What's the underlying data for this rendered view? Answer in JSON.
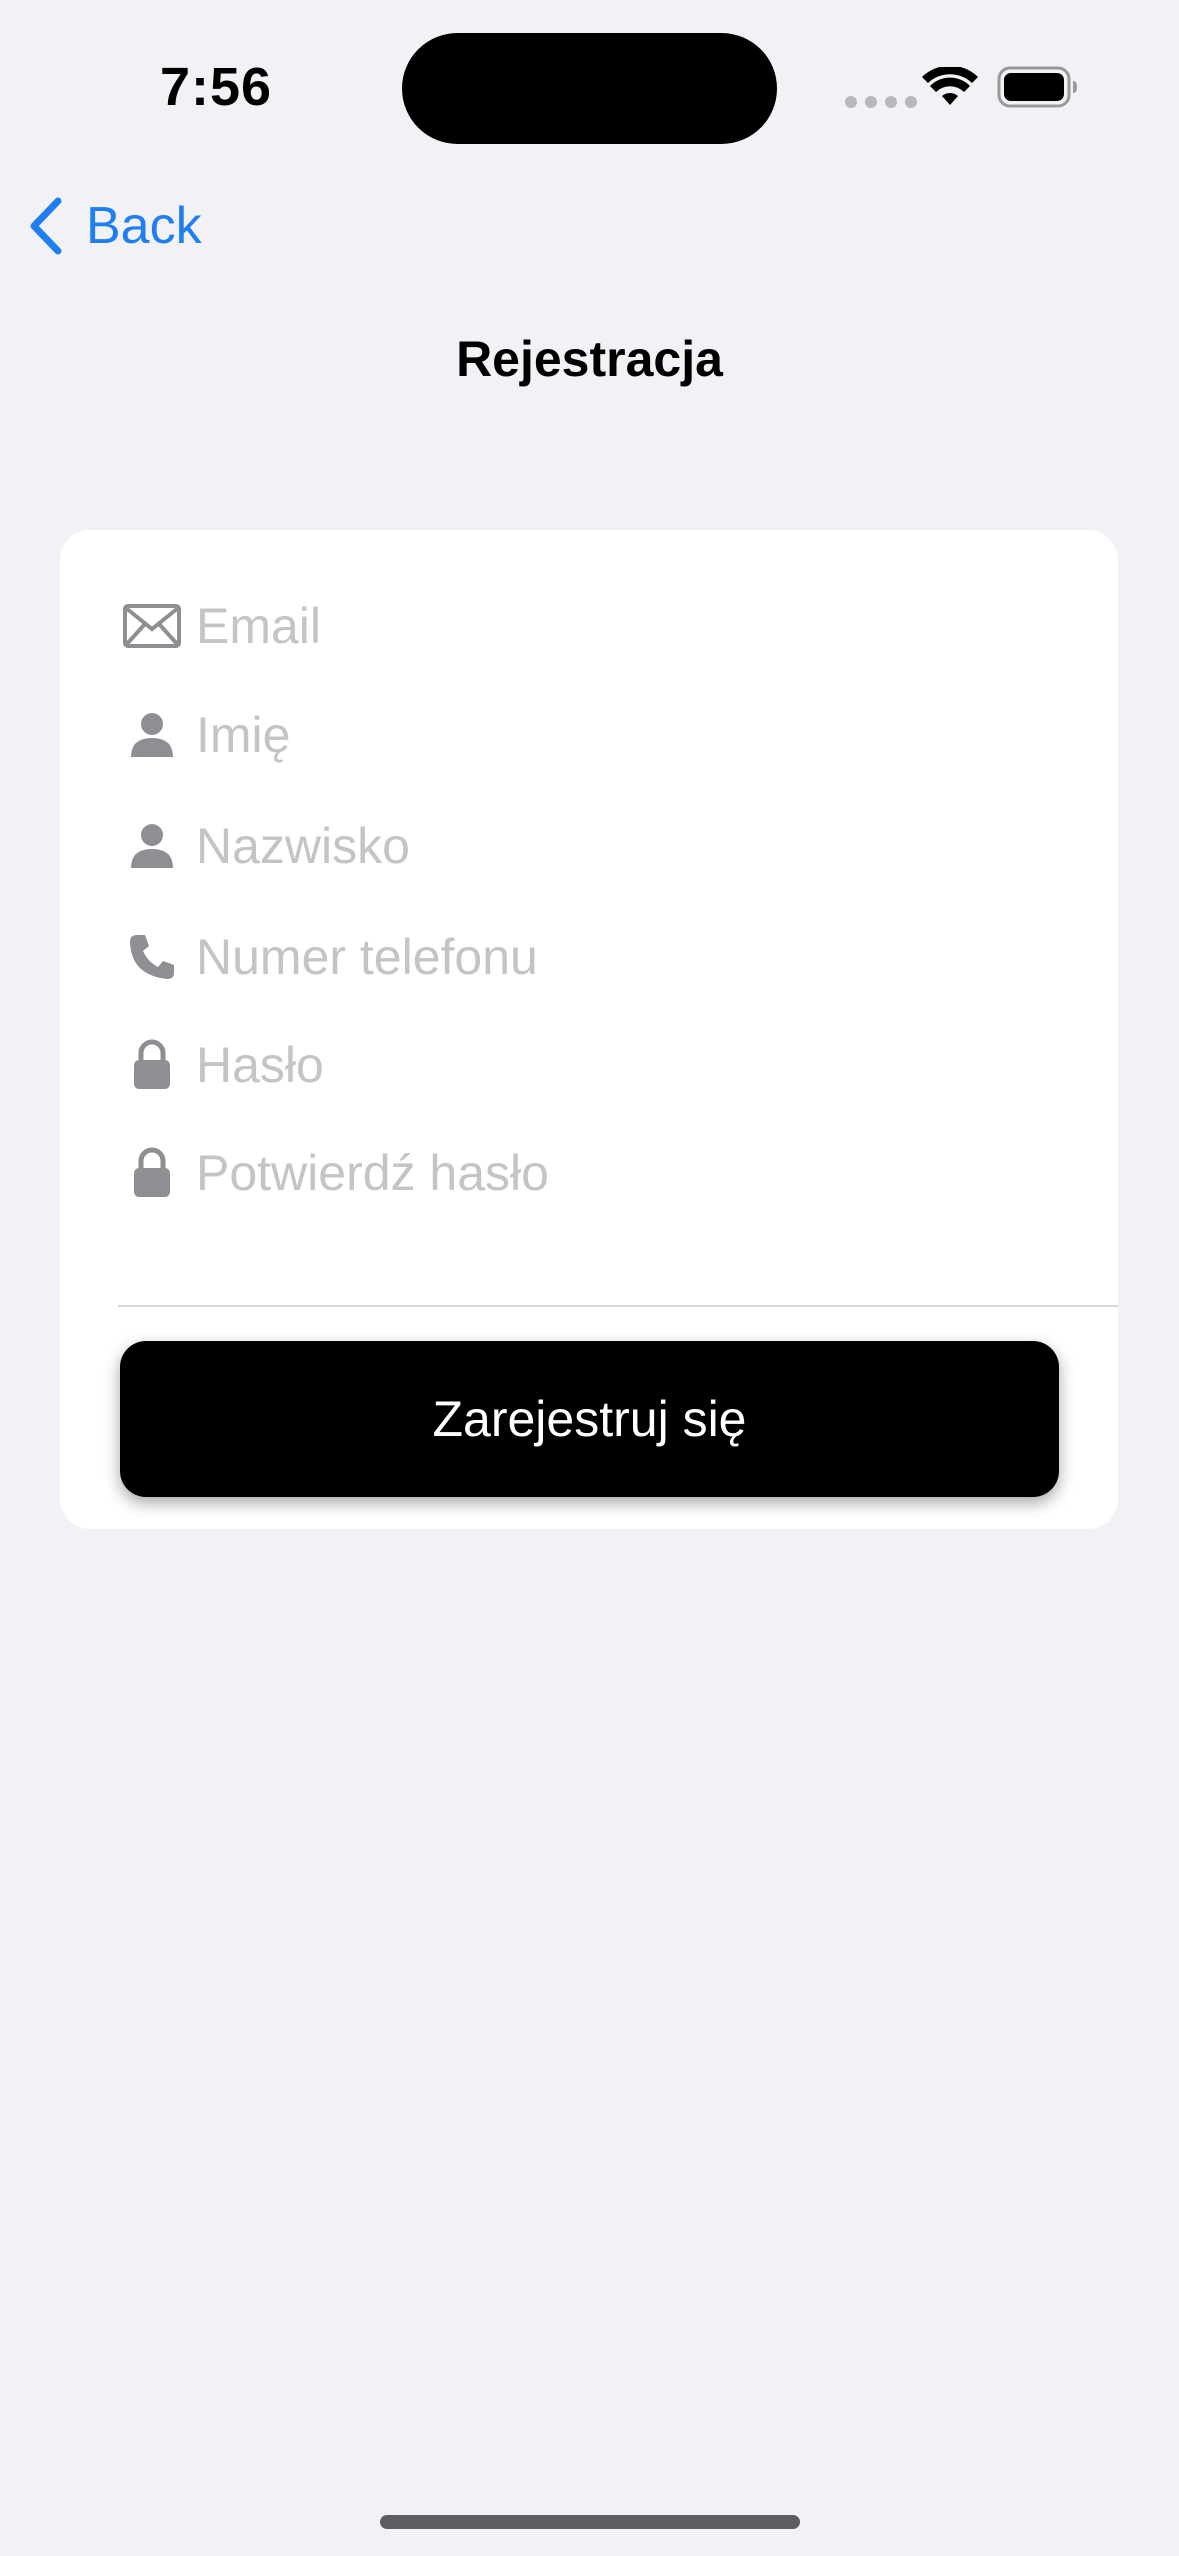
{
  "status_bar": {
    "time": "7:56"
  },
  "nav": {
    "back_label": "Back",
    "title": "Rejestracja"
  },
  "form": {
    "fields": [
      {
        "placeholder": "Email",
        "value": "",
        "icon": "envelope-icon"
      },
      {
        "placeholder": "Imię",
        "value": "",
        "icon": "person-icon"
      },
      {
        "placeholder": "Nazwisko",
        "value": "",
        "icon": "person-icon"
      },
      {
        "placeholder": "Numer telefonu",
        "value": "",
        "icon": "phone-icon"
      },
      {
        "placeholder": "Hasło",
        "value": "",
        "icon": "lock-icon"
      },
      {
        "placeholder": "Potwierdź hasło",
        "value": "",
        "icon": "lock-icon"
      }
    ],
    "submit_label": "Zarejestruj się"
  },
  "colors": {
    "background": "#f2f1f6",
    "accent": "#1f7ef0",
    "icon_gray": "#8e8e93",
    "placeholder": "#c4c4c7",
    "button": "#000000"
  }
}
